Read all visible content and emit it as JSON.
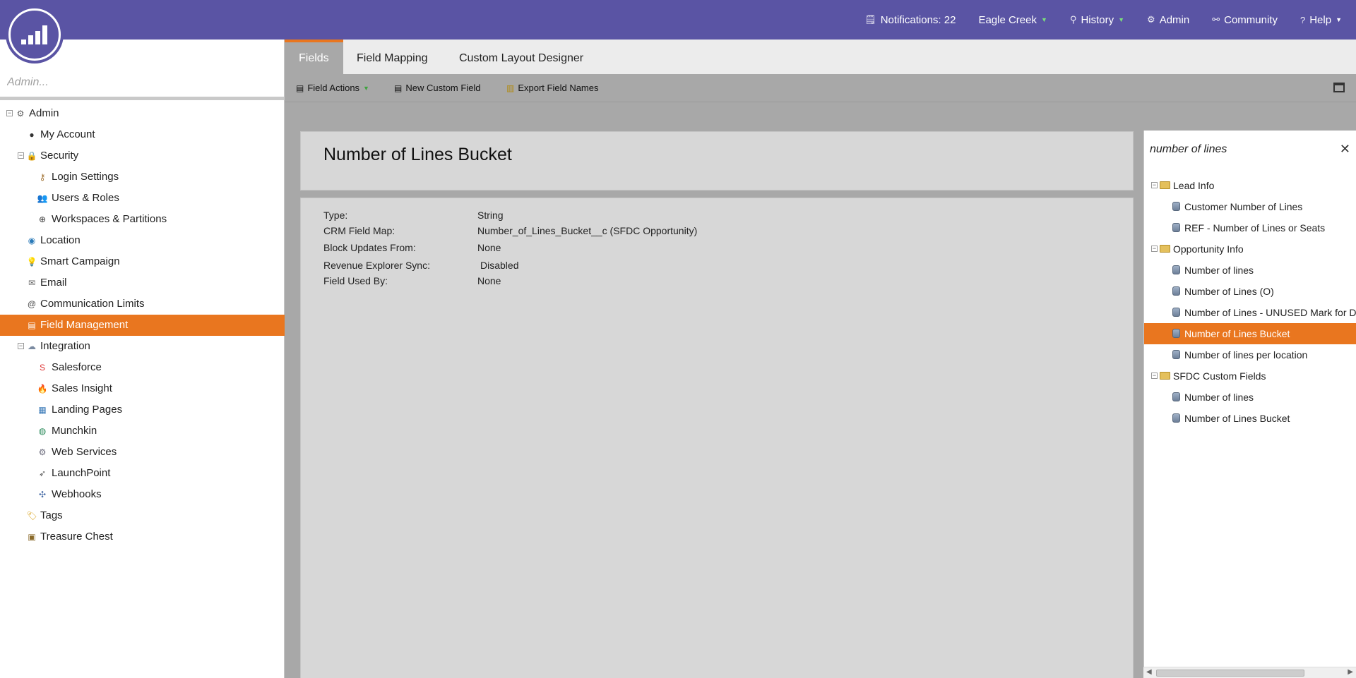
{
  "topnav": {
    "notifications": "Notifications: 22",
    "workspace": "Eagle Creek",
    "history": "History",
    "admin": "Admin",
    "community": "Community",
    "help": "Help"
  },
  "left": {
    "search_placeholder": "Admin...",
    "tree": {
      "admin": "Admin",
      "my_account": "My Account",
      "security": "Security",
      "login_settings": "Login Settings",
      "users_roles": "Users & Roles",
      "workspaces": "Workspaces & Partitions",
      "location": "Location",
      "smart_campaign": "Smart Campaign",
      "email": "Email",
      "communication_limits": "Communication Limits",
      "field_management": "Field Management",
      "integration": "Integration",
      "salesforce": "Salesforce",
      "sales_insight": "Sales Insight",
      "landing_pages": "Landing Pages",
      "munchkin": "Munchkin",
      "web_services": "Web Services",
      "launchpoint": "LaunchPoint",
      "webhooks": "Webhooks",
      "tags": "Tags",
      "treasure_chest": "Treasure Chest"
    }
  },
  "tabs": {
    "fields": "Fields",
    "field_mapping": "Field Mapping",
    "custom_layout": "Custom Layout Designer"
  },
  "toolbar": {
    "field_actions": "Field Actions",
    "new_custom_field": "New Custom Field",
    "export_field_names": "Export Field Names"
  },
  "field": {
    "title": "Number of Lines Bucket",
    "properties": {
      "type_label": "Type:",
      "type_value": "String",
      "crm_label": "CRM Field Map:",
      "crm_value": "Number_of_Lines_Bucket__c (SFDC Opportunity)",
      "block_label": "Block Updates From:",
      "block_value": "None",
      "revenue_label": "Revenue Explorer Sync:",
      "revenue_value": "Disabled",
      "used_label": "Field Used By:",
      "used_value": "None"
    }
  },
  "search_panel": {
    "query": "number of lines",
    "groups": {
      "lead_info": "Lead Info",
      "customer_number": "Customer Number of Lines",
      "ref_number": "REF - Number of Lines or Seats",
      "opportunity_info": "Opportunity Info",
      "opp_number_of_lines": "Number of lines",
      "opp_number_of_lines_o": "Number of Lines (O)",
      "opp_unused": "Number of Lines - UNUSED Mark for Deletion",
      "opp_bucket": "Number of Lines Bucket",
      "opp_per_location": "Number of lines per location",
      "sfdc_custom": "SFDC Custom Fields",
      "sfdc_number_of_lines": "Number of lines",
      "sfdc_bucket": "Number of Lines Bucket"
    }
  },
  "colors": {
    "brand_purple": "#5a54a4",
    "accent_orange": "#e9761f"
  }
}
